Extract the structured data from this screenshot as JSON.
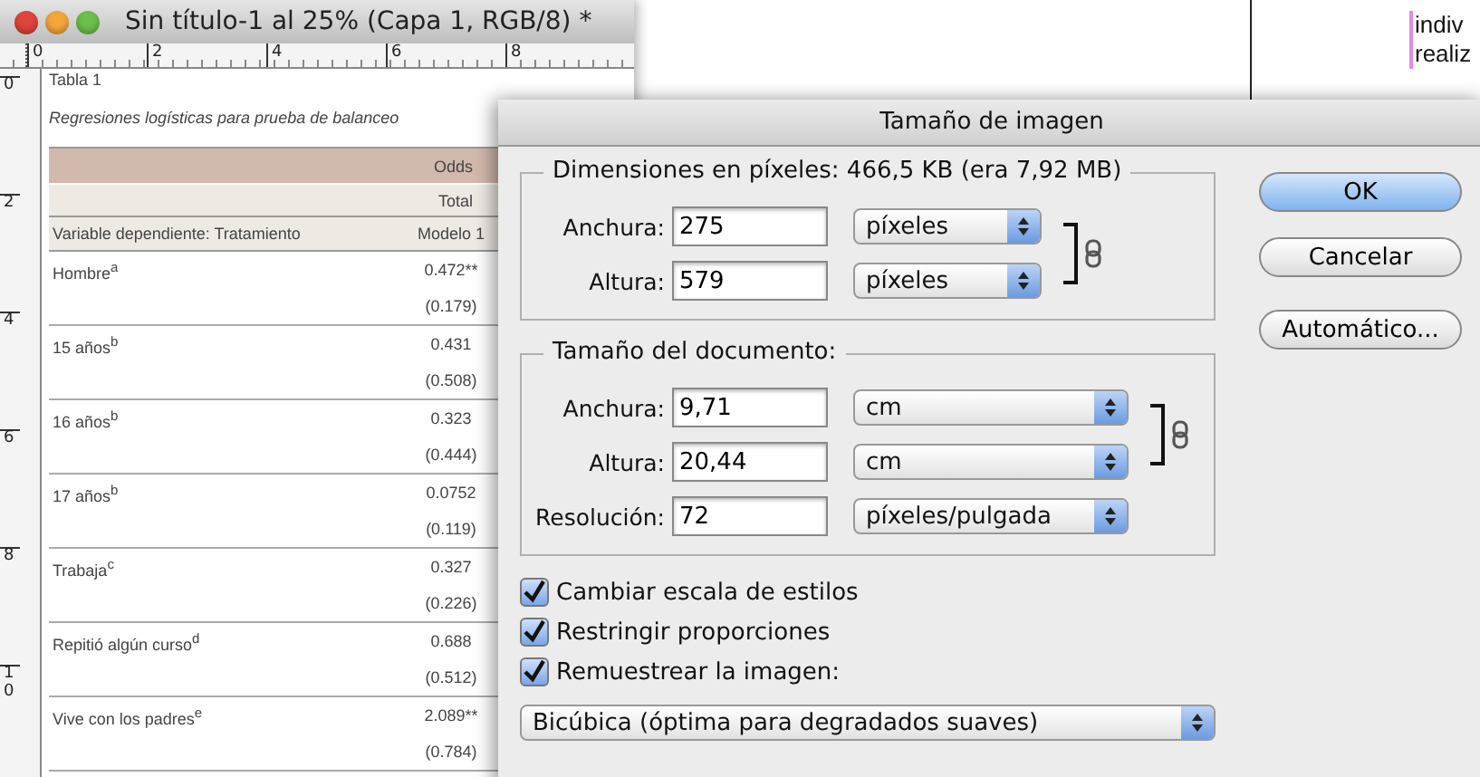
{
  "document_window": {
    "title": "Sin título-1 al 25% (Capa 1, RGB/8) *",
    "ruler_h": [
      "0",
      "2",
      "4",
      "6",
      "8"
    ],
    "ruler_v": [
      "0",
      "2",
      "4",
      "6",
      "8",
      "10"
    ],
    "table": {
      "title": "Tabla 1",
      "subtitle": "Regresiones logísticas para prueba de balanceo",
      "header": "Odds",
      "subheader": "Total",
      "column_label": "Variable dependiente: Tratamiento",
      "column_model": "Modelo 1",
      "rows": [
        {
          "label": "Hombre$^{a}$",
          "coef": "0.472**",
          "se": "(0.179)"
        },
        {
          "label": "15 años$^{b}$",
          "coef": "0.431",
          "se": "(0.508)"
        },
        {
          "label": "16 años$^{b}$",
          "coef": "0.323",
          "se": "(0.444)"
        },
        {
          "label": "17 años$^{b}$",
          "coef": "0.0752",
          "se": "(0.119)"
        },
        {
          "label": "Trabaja$^{c}$",
          "coef": "0.327",
          "se": "(0.226)"
        },
        {
          "label": "Repitió algún curso$^{d}$",
          "coef": "0.688",
          "se": "(0.512)"
        },
        {
          "label": "Vive con los padres$^{e}$",
          "coef": "2.089**",
          "se": "(0.784)"
        }
      ]
    }
  },
  "background_page": {
    "lines": [
      "indiv",
      "realiz"
    ]
  },
  "dialog": {
    "title": "Tamaño de imagen",
    "groups": [
      {
        "legend": "Dimensiones en píxeles: 466,5 KB (era 7,92 MB)",
        "linked": true,
        "rows": [
          {
            "label": "Anchura:",
            "value": "275",
            "unit": "píxeles"
          },
          {
            "label": "Altura:",
            "value": "579",
            "unit": "píxeles"
          }
        ]
      },
      {
        "legend": "Tamaño del documento:",
        "linked": true,
        "rows": [
          {
            "label": "Anchura:",
            "value": "9,71",
            "unit": "cm"
          },
          {
            "label": "Altura:",
            "value": "20,44",
            "unit": "cm"
          },
          {
            "label": "Resolución:",
            "value": "72",
            "unit": "píxeles/pulgada"
          }
        ]
      }
    ],
    "checkboxes": [
      {
        "label": "Cambiar escala de estilos",
        "checked": true
      },
      {
        "label": "Restringir proporciones",
        "checked": true
      },
      {
        "label": "Remuestrear la imagen:",
        "checked": true
      }
    ],
    "resample_method": "Bicúbica (óptima para degradados suaves)",
    "buttons": [
      {
        "label": "OK",
        "default": true
      },
      {
        "label": "Cancelar",
        "default": false
      },
      {
        "label": "Automático...",
        "default": false
      }
    ]
  }
}
